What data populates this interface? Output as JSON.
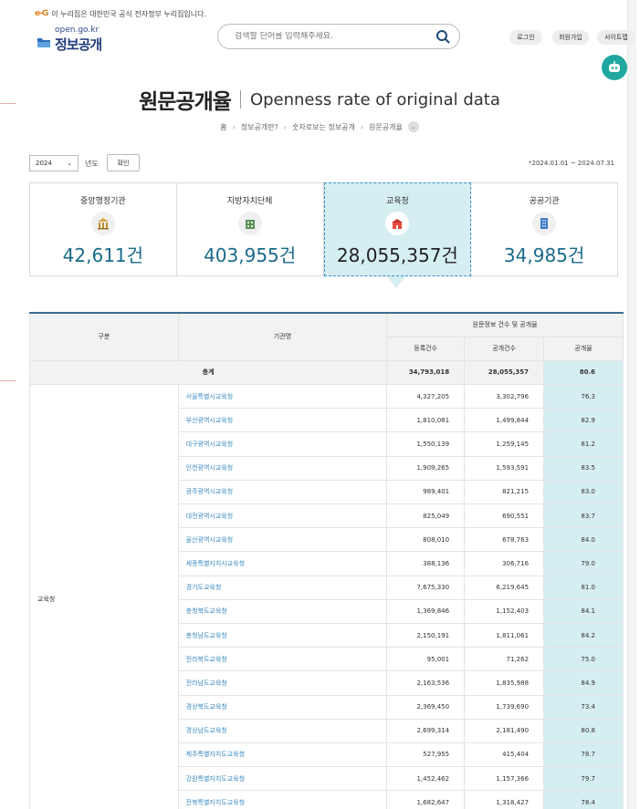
{
  "header": {
    "gov_notice_mark": "e-G",
    "gov_notice": "이 누리집은 대한민국 공식 전자정부 누리집입니다.",
    "logo_domain": "open.go.kr",
    "logo_brand": "정보공개",
    "search_placeholder": "검색할 단어를 입력해주세요.",
    "login": "로그인",
    "signup": "회원가입",
    "sitemap": "사이트맵"
  },
  "page": {
    "title_ko": "원문공개율",
    "title_en": "Openness rate of original data",
    "breadcrumb": [
      "홈",
      "정보공개란?",
      "숫자로보는 정보공개",
      "원문공개율"
    ]
  },
  "filter": {
    "year": "2024",
    "year_label": "년도",
    "confirm": "확인",
    "period": "*2024.01.01 ~ 2024.07.31"
  },
  "cards": [
    {
      "label": "중앙행정기관",
      "value": "42,611건",
      "icon": "museum-icon"
    },
    {
      "label": "지방자치단체",
      "value": "403,955건",
      "icon": "city-building-icon"
    },
    {
      "label": "교육청",
      "value": "28,055,357건",
      "icon": "school-icon"
    },
    {
      "label": "공공기관",
      "value": "34,985건",
      "icon": "office-building-icon"
    }
  ],
  "table": {
    "headers": {
      "category": "구분",
      "org": "기관명",
      "group": "원문정보 건수 및 공개율",
      "registered": "등록건수",
      "disclosed": "공개건수",
      "rate": "공개율"
    },
    "total": {
      "label": "총계",
      "registered": "34,793,018",
      "disclosed": "28,055,357",
      "rate": "80.6"
    },
    "category": "교육청",
    "rows": [
      {
        "org": "서울특별시교육청",
        "registered": "4,327,205",
        "disclosed": "3,302,796",
        "rate": "76.3"
      },
      {
        "org": "부산광역시교육청",
        "registered": "1,810,081",
        "disclosed": "1,499,844",
        "rate": "82.9"
      },
      {
        "org": "대구광역시교육청",
        "registered": "1,550,139",
        "disclosed": "1,259,145",
        "rate": "81.2"
      },
      {
        "org": "인천광역시교육청",
        "registered": "1,909,265",
        "disclosed": "1,593,591",
        "rate": "83.5"
      },
      {
        "org": "광주광역시교육청",
        "registered": "989,401",
        "disclosed": "821,215",
        "rate": "83.0"
      },
      {
        "org": "대전광역시교육청",
        "registered": "825,049",
        "disclosed": "690,551",
        "rate": "83.7"
      },
      {
        "org": "울산광역시교육청",
        "registered": "808,010",
        "disclosed": "678,763",
        "rate": "84.0"
      },
      {
        "org": "세종특별자치시교육청",
        "registered": "388,136",
        "disclosed": "306,716",
        "rate": "79.0"
      },
      {
        "org": "경기도교육청",
        "registered": "7,675,330",
        "disclosed": "6,219,645",
        "rate": "81.0"
      },
      {
        "org": "충청북도교육청",
        "registered": "1,369,846",
        "disclosed": "1,152,403",
        "rate": "84.1"
      },
      {
        "org": "충청남도교육청",
        "registered": "2,150,191",
        "disclosed": "1,811,061",
        "rate": "84.2"
      },
      {
        "org": "전라북도교육청",
        "registered": "95,001",
        "disclosed": "71,262",
        "rate": "75.0"
      },
      {
        "org": "전라남도교육청",
        "registered": "2,163,536",
        "disclosed": "1,835,988",
        "rate": "84.9"
      },
      {
        "org": "경상북도교육청",
        "registered": "2,369,450",
        "disclosed": "1,739,690",
        "rate": "73.4"
      },
      {
        "org": "경상남도교육청",
        "registered": "2,699,314",
        "disclosed": "2,181,490",
        "rate": "80.8"
      },
      {
        "org": "제주특별자치도교육청",
        "registered": "527,955",
        "disclosed": "415,404",
        "rate": "78.7"
      },
      {
        "org": "강원특별자치도교육청",
        "registered": "1,452,462",
        "disclosed": "1,157,366",
        "rate": "79.7"
      },
      {
        "org": "전북특별자치도교육청",
        "registered": "1,682,647",
        "disclosed": "1,318,427",
        "rate": "78.4"
      }
    ]
  }
}
